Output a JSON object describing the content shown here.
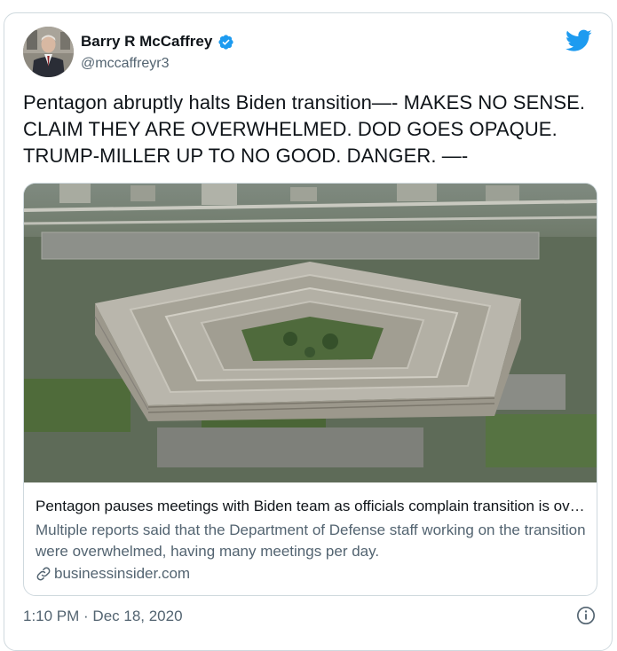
{
  "author": {
    "display_name": "Barry R McCaffrey",
    "handle": "@mccaffreyr3",
    "verified": true,
    "avatar_icon": "author-avatar-photo"
  },
  "brand_icon": "twitter-bird-icon",
  "tweet": {
    "text": "Pentagon abruptly halts Biden transition—- MAKES NO SENSE. CLAIM THEY ARE OVERWHELMED. DOD GOES OPAQUE. TRUMP-MILLER UP TO NO GOOD. DANGER. —-",
    "timestamp": "1:10 PM · Dec 18, 2020"
  },
  "link_card": {
    "image_icon": "pentagon-aerial-photo",
    "title": "Pentagon pauses meetings with Biden team as officials complain transition is overwhelming",
    "description": "Multiple reports said that the Department of Defense staff working on the transition were overwhelmed, having many meetings per day.",
    "domain": "businessinsider.com"
  },
  "colors": {
    "accent": "#1d9bf0",
    "text_primary": "#0f1419",
    "text_secondary": "#536471",
    "border": "#cfd9de"
  }
}
